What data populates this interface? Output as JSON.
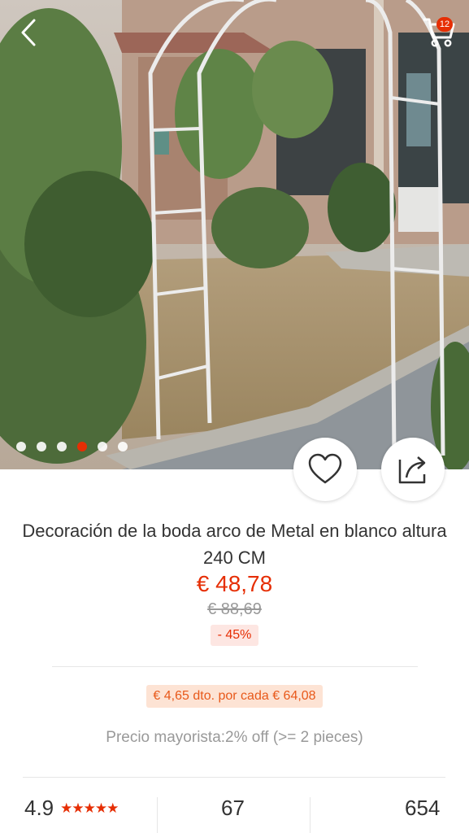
{
  "header": {
    "cart_count": "12"
  },
  "gallery": {
    "total": 6,
    "active_index": 3
  },
  "product": {
    "title": "Decoración de la boda arco de Metal en blanco altura 240 CM",
    "price": "€ 48,78",
    "original_price": "€ 88,69",
    "discount": "- 45%"
  },
  "promo": {
    "coupon": "€ 4,65 dto. por cada € 64,08",
    "wholesale": "Precio mayorista:2% off (>= 2 pieces)"
  },
  "stats": {
    "rating": "4.9",
    "stars": "★★★★★",
    "orders": "67",
    "wishlist": "654"
  },
  "colors": {
    "accent": "#e62e04",
    "coupon_bg": "#fde3d4",
    "discount_bg": "#fde6e2"
  }
}
